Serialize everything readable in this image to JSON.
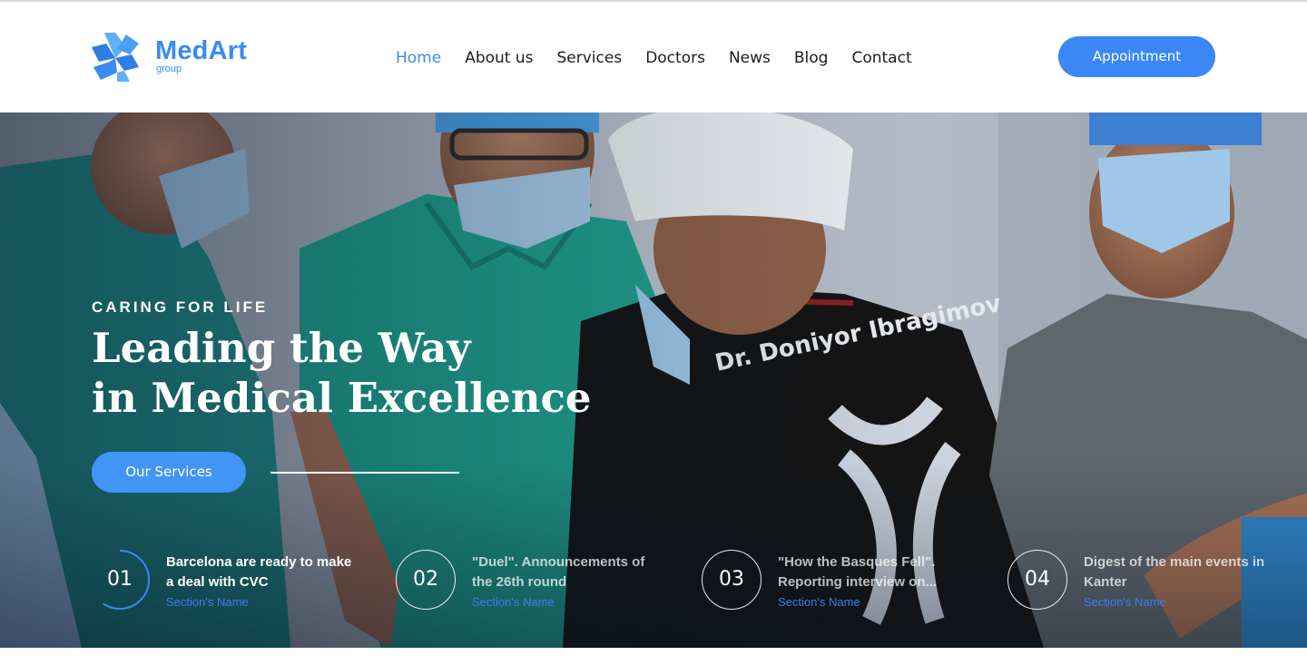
{
  "brand": {
    "name": "MedArt",
    "sub": "group",
    "accent": "#3a8bf2"
  },
  "nav": {
    "items": [
      {
        "label": "Home",
        "active": true
      },
      {
        "label": "About us",
        "active": false
      },
      {
        "label": "Services",
        "active": false
      },
      {
        "label": "Doctors",
        "active": false
      },
      {
        "label": "News",
        "active": false
      },
      {
        "label": "Blog",
        "active": false
      },
      {
        "label": "Contact",
        "active": false
      }
    ],
    "appointment_label": "Appointment"
  },
  "hero": {
    "eyebrow": "CARING FOR LIFE",
    "headline_line1": "Leading the Way",
    "headline_line2": "in Medical Excellence",
    "cta_label": "Our Services",
    "slides": [
      {
        "number": "01",
        "title": "Barcelona are ready to make a deal with CVC",
        "section": "Section's Name",
        "active": true
      },
      {
        "number": "02",
        "title": "\"Duel\". Announcements of the 26th round",
        "section": "Section's Name",
        "active": false
      },
      {
        "number": "03",
        "title": "\"How the Basques Fell\". Reporting interview on...",
        "section": "Section's Name",
        "active": false
      },
      {
        "number": "04",
        "title": "Digest of the main events in Kanter",
        "section": "Section's Name",
        "active": false
      }
    ]
  },
  "colors": {
    "primary": "#3a87f5",
    "text": "#1c1c1c"
  }
}
